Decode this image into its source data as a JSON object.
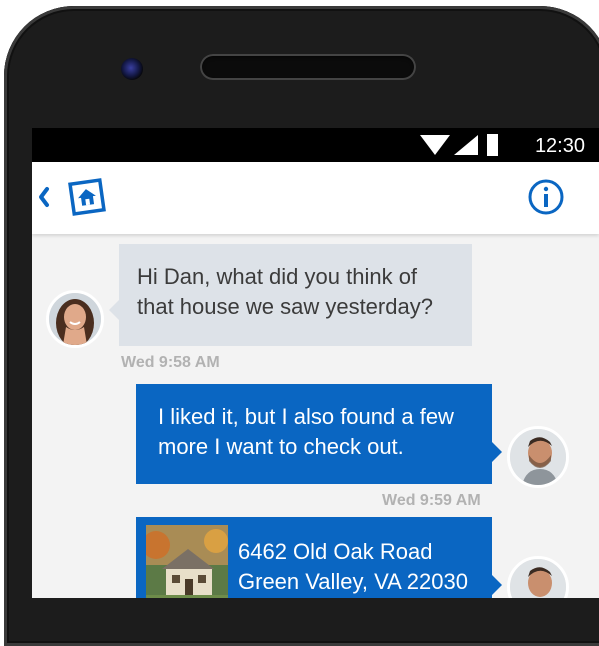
{
  "status_bar": {
    "time": "12:30"
  },
  "app_bar": {
    "back_icon": "chevron-left-icon",
    "logo_icon": "home-logo-icon",
    "info_icon": "info-circle-icon",
    "accent_color": "#0a66c2"
  },
  "messages": [
    {
      "sender": "agent",
      "lines": [
        "Hi Dan, what did you think of",
        "that house we saw yesterday?"
      ],
      "timestamp": "Wed 9:58 AM"
    },
    {
      "sender": "user",
      "lines": [
        "I liked it, but I also found a few",
        "more I want to check out."
      ],
      "timestamp": "Wed 9:59 AM"
    },
    {
      "sender": "user",
      "type": "listing",
      "address_line1": "6462 Old Oak Road",
      "address_line2": "Green Valley, VA 22030"
    }
  ],
  "colors": {
    "incoming_bubble": "#dde2e8",
    "outgoing_bubble": "#0a66c2",
    "timestamp": "#b2b2b2",
    "chat_background": "#f3f3f3"
  }
}
